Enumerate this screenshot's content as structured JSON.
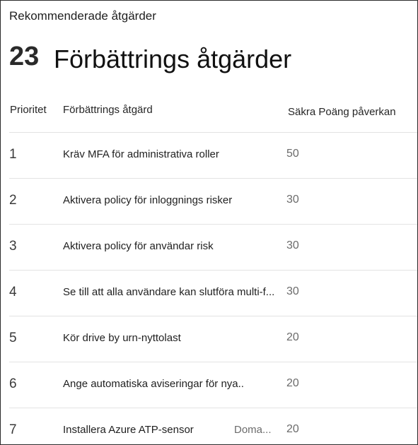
{
  "card": {
    "title": "Rekommenderade åtgärder",
    "count": "23",
    "headline": "Förbättrings åtgärder"
  },
  "columns": {
    "priority": "Prioritet",
    "action": "Förbättrings åtgärd",
    "impact": "Säkra Poäng påverkan"
  },
  "rows": [
    {
      "priority": "1",
      "action": "Kräv MFA för administrativa roller",
      "impact": "50",
      "extra": ""
    },
    {
      "priority": "2",
      "action": "Aktivera policy för inloggnings risker",
      "impact": "30",
      "extra": ""
    },
    {
      "priority": "3",
      "action": "Aktivera policy för användar risk",
      "impact": "30",
      "extra": ""
    },
    {
      "priority": "4",
      "action": "Se till att alla användare kan slutföra multi-f...",
      "impact": "30",
      "extra": ""
    },
    {
      "priority": "5",
      "action": "Kör drive by urn-nyttolast",
      "impact": "20",
      "extra": ""
    },
    {
      "priority": "6",
      "action": "Ange automatiska aviseringar för nya..",
      "impact": "20",
      "extra": ""
    },
    {
      "priority": "7",
      "action": "Installera Azure ATP-sensor",
      "impact": "20",
      "extra": "Doma..."
    }
  ]
}
